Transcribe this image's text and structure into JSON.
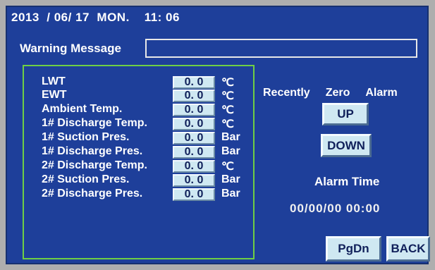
{
  "status_bar": {
    "datetime": "2013  / 06/ 17  MON.    11: 06"
  },
  "warning": {
    "label": "Warning Message",
    "value": ""
  },
  "parameters": [
    {
      "label": "LWT",
      "value": "0. 0",
      "unit": "℃"
    },
    {
      "label": "EWT",
      "value": "0. 0",
      "unit": "℃"
    },
    {
      "label": "Ambient Temp.",
      "value": "0. 0",
      "unit": "℃"
    },
    {
      "label": "1# Discharge Temp.",
      "value": "0. 0",
      "unit": "℃"
    },
    {
      "label": "1# Suction Pres.",
      "value": "0. 0",
      "unit": "Bar"
    },
    {
      "label": "1# Discharge Pres.",
      "value": "0. 0",
      "unit": "Bar"
    },
    {
      "label": "2# Discharge Temp.",
      "value": "0. 0",
      "unit": "℃"
    },
    {
      "label": "2# Suction Pres.",
      "value": "0. 0",
      "unit": "Bar"
    },
    {
      "label": "2# Discharge Pres.",
      "value": "0. 0",
      "unit": "Bar"
    }
  ],
  "alarm": {
    "header_recently": "Recently",
    "header_zero": "Zero",
    "header_alarm": "Alarm",
    "up_label": "UP",
    "down_label": "DOWN",
    "time_title": "Alarm Time",
    "time_value": "00/00/00 00:00"
  },
  "nav": {
    "pgdn_label": "PgDn",
    "back_label": "BACK"
  },
  "colors": {
    "screen_bg": "#1e3f9a",
    "panel_border": "#6fcf44",
    "button_face": "#cfe8f2"
  }
}
